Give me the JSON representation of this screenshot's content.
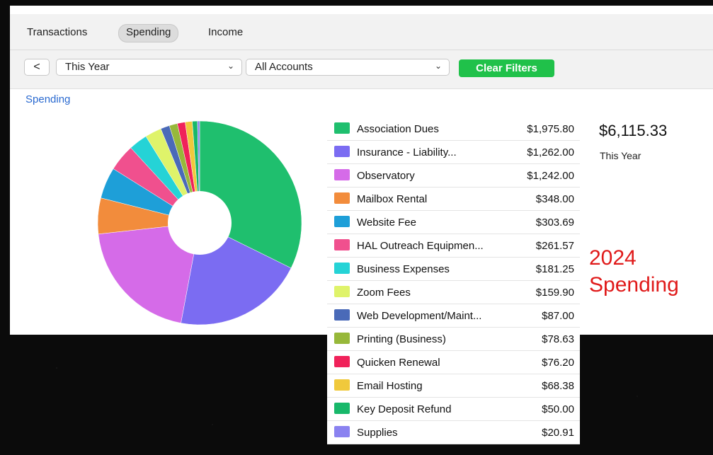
{
  "tabs": [
    {
      "label": "Transactions",
      "active": false
    },
    {
      "label": "Spending",
      "active": true
    },
    {
      "label": "Income",
      "active": false
    }
  ],
  "filters": {
    "back_glyph": "<",
    "period": "This Year",
    "accounts": "All Accounts",
    "clear_label": "Clear Filters"
  },
  "section_title": "Spending",
  "total": {
    "amount": "$6,115.33",
    "period": "This Year"
  },
  "annotation": {
    "line1": "2024",
    "line2": "Spending"
  },
  "chart_data": {
    "type": "pie",
    "donut": true,
    "categories": [
      "Association Dues",
      "Insurance - Liability...",
      "Observatory",
      "Mailbox Rental",
      "Website Fee",
      "HAL Outreach Equipmen...",
      "Business Expenses",
      "Zoom Fees",
      "Web Development/Maint...",
      "Printing (Business)",
      "Quicken Renewal",
      "Email Hosting",
      "Key Deposit Refund",
      "Supplies"
    ],
    "amounts": [
      "$1,975.80",
      "$1,262.00",
      "$1,242.00",
      "$348.00",
      "$303.69",
      "$261.57",
      "$181.25",
      "$159.90",
      "$87.00",
      "$78.63",
      "$76.20",
      "$68.38",
      "$50.00",
      "$20.91"
    ],
    "values": [
      1975.8,
      1262.0,
      1242.0,
      348.0,
      303.69,
      261.57,
      181.25,
      159.9,
      87.0,
      78.63,
      76.2,
      68.38,
      50.0,
      20.91
    ],
    "colors": [
      "#1fbf6e",
      "#7b6cf2",
      "#d56be8",
      "#f28c3c",
      "#1e9fd8",
      "#f0508e",
      "#25d3d6",
      "#dff36a",
      "#4a6ab8",
      "#97b83a",
      "#f0225a",
      "#f0c93c",
      "#18b86a",
      "#8a82f0"
    ]
  }
}
